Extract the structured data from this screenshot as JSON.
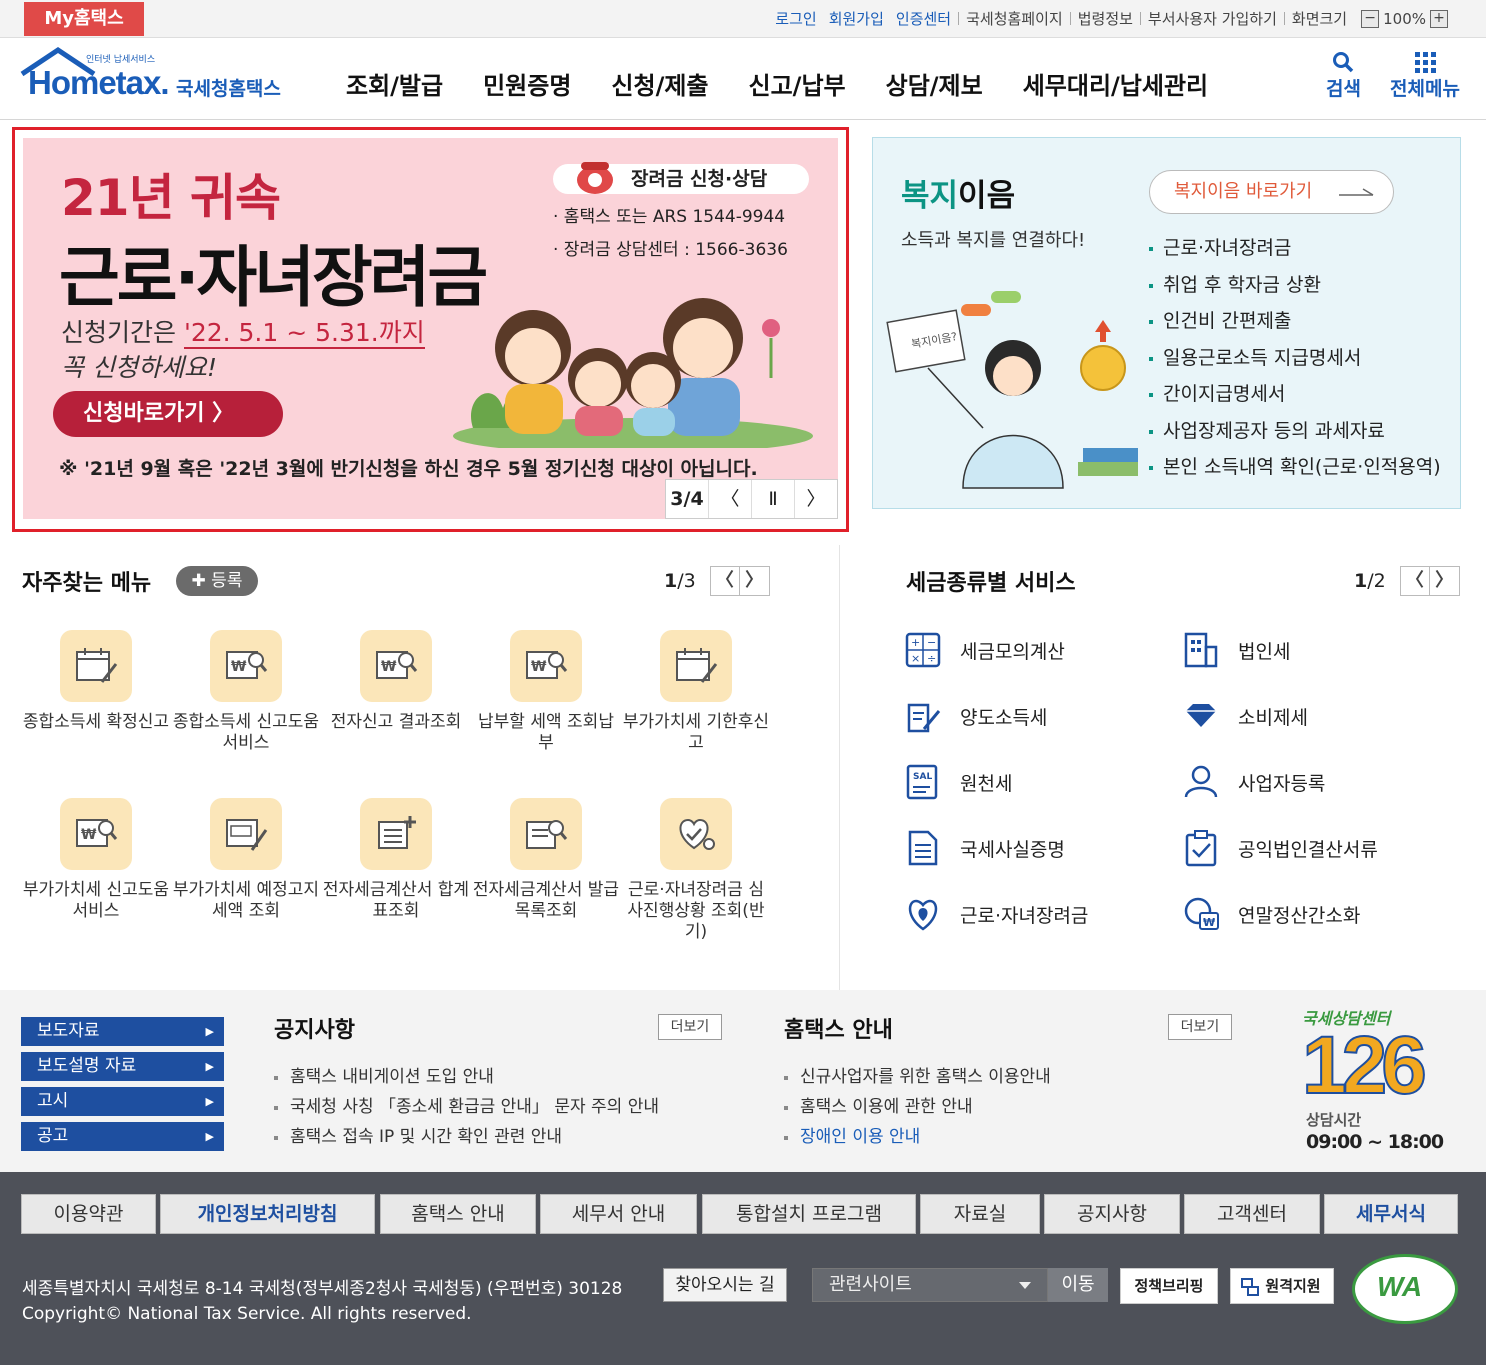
{
  "topbar": {
    "my_hometax": "My홈택스",
    "login": "로그인",
    "signup": "회원가입",
    "cert_center": "인증센터",
    "nts_homepage": "국세청홈페이지",
    "law_info": "법령정보",
    "dept_signup": "부서사용자 가입하기",
    "screen_size": "화면크기",
    "zoom_minus": "−",
    "zoom_value": "100%",
    "zoom_plus": "+"
  },
  "logo": {
    "tagline": "인터넷 납세서비스",
    "brand": "Hometax.",
    "name": "국세청홈택스"
  },
  "gnb": {
    "items": [
      "조회/발급",
      "민원증명",
      "신청/제출",
      "신고/납부",
      "상담/제보",
      "세무대리/납세관리"
    ],
    "search": "검색",
    "all_menu": "전체메뉴"
  },
  "banner": {
    "title1": "21년 귀속",
    "title2": "근로·자녀장려금",
    "period_prefix": "신청기간은 ",
    "period_highlight": "'22. 5.1 ~ 5.31.까지",
    "period_line2": "꼭 신청하세요!",
    "apply_button": "신청바로가기 〉",
    "note": "※ '21년 9월 혹은 '22년 3월에 반기신청을 하신 경우 5월 정기신청 대상이 아닙니다.",
    "contact_head": "장려금 신청·상담",
    "contact_line1": "· 홈택스 또는 ARS 1544-9944",
    "contact_line2": "· 장려금 상담센터 : 1566-3636",
    "counter": "3/4",
    "prev": "〈",
    "pause": "Ⅱ",
    "next": "〉",
    "accent_color": "#c4253f"
  },
  "welfare": {
    "title_green": "복지",
    "title_rest": "이음",
    "subtitle": "소득과 복지를 연결하다!",
    "go_button": "복지이음 바로가기",
    "illustration_label": "복지이음?",
    "list": [
      "근로·자녀장려금",
      "취업 후 학자금 상환",
      "인건비 간편제출",
      "일용근로소득 지급명세서",
      "간이지급명세서",
      "사업장제공자 등의 과세자료",
      "본인 소득내역 확인(근로·인적용역)"
    ]
  },
  "favorites": {
    "title": "자주찾는 메뉴",
    "add": "✚ 등록",
    "page_current": "1",
    "page_total": "/3",
    "prev": "〈",
    "next": "〉",
    "items": [
      {
        "label": "종합소득세 확정신고",
        "icon": "calendar-pen-icon"
      },
      {
        "label": "종합소득세 신고도움 서비스",
        "icon": "won-search-icon"
      },
      {
        "label": "전자신고 결과조회",
        "icon": "won-search-icon"
      },
      {
        "label": "납부할 세액 조회납부",
        "icon": "won-search-icon"
      },
      {
        "label": "부가가치세 기한후신고",
        "icon": "calendar-pen-icon"
      },
      {
        "label": "부가가치세 신고도움 서비스",
        "icon": "won-search-icon"
      },
      {
        "label": "부가가치세 예정고지세액 조회",
        "icon": "vat-pen-icon"
      },
      {
        "label": "전자세금계산서 합계표조회",
        "icon": "document-plus-icon"
      },
      {
        "label": "전자세금계산서 발급목록조회",
        "icon": "document-search-icon"
      },
      {
        "label": "근로·자녀장려금 심사진행상황 조회(반기)",
        "icon": "heart-check-icon"
      }
    ]
  },
  "taxtypes": {
    "title": "세금종류별 서비스",
    "page_current": "1",
    "page_total": "/2",
    "prev": "〈",
    "next": "〉",
    "items": [
      {
        "label": "세금모의계산",
        "icon": "calculator-icon"
      },
      {
        "label": "법인세",
        "icon": "building-icon"
      },
      {
        "label": "양도소득세",
        "icon": "document-edit-icon"
      },
      {
        "label": "소비제세",
        "icon": "diamond-icon"
      },
      {
        "label": "원천세",
        "icon": "salary-icon"
      },
      {
        "label": "사업자등록",
        "icon": "person-icon"
      },
      {
        "label": "국세사실증명",
        "icon": "certificate-icon"
      },
      {
        "label": "공익법인결산서류",
        "icon": "clipboard-check-icon"
      },
      {
        "label": "근로·자녀장려금",
        "icon": "heart-leaf-icon"
      },
      {
        "label": "연말정산간소화",
        "icon": "won-cycle-icon"
      }
    ]
  },
  "sidebuttons": [
    "보도자료",
    "보도설명 자료",
    "고시",
    "공고"
  ],
  "notice": {
    "title": "공지사항",
    "more": "더보기",
    "items": [
      "홈택스 내비게이션 도입 안내",
      "국세청 사칭 「종소세 환급금 안내」 문자 주의 안내",
      "홈택스 접속 IP 및 시간 확인 관련 안내"
    ]
  },
  "guide": {
    "title": "홈택스 안내",
    "more": "더보기",
    "items": [
      "신규사업자를 위한 홈택스 이용안내",
      "홈택스 이용에 관한 안내",
      "장애인 이용 안내"
    ]
  },
  "center126": {
    "title": "국세상담센터",
    "number": "126",
    "hours_label": "상담시간",
    "hours": "09:00 ~ 18:00"
  },
  "footer": {
    "links": [
      "이용약관",
      "개인정보처리방침",
      "홈택스 안내",
      "세무서 안내",
      "통합설치 프로그램",
      "자료실",
      "공지사항",
      "고객센터",
      "세무서식"
    ],
    "address": "세종특별자치시 국세청로 8-14 국세청(정부세종2청사 국세청동) (우편번호) 30128",
    "directions": "찾아오시는 길",
    "related_sites": "관련사이트",
    "go": "이동",
    "policy": "정책브리핑",
    "remote": "원격지원",
    "wa": "WA"
  }
}
